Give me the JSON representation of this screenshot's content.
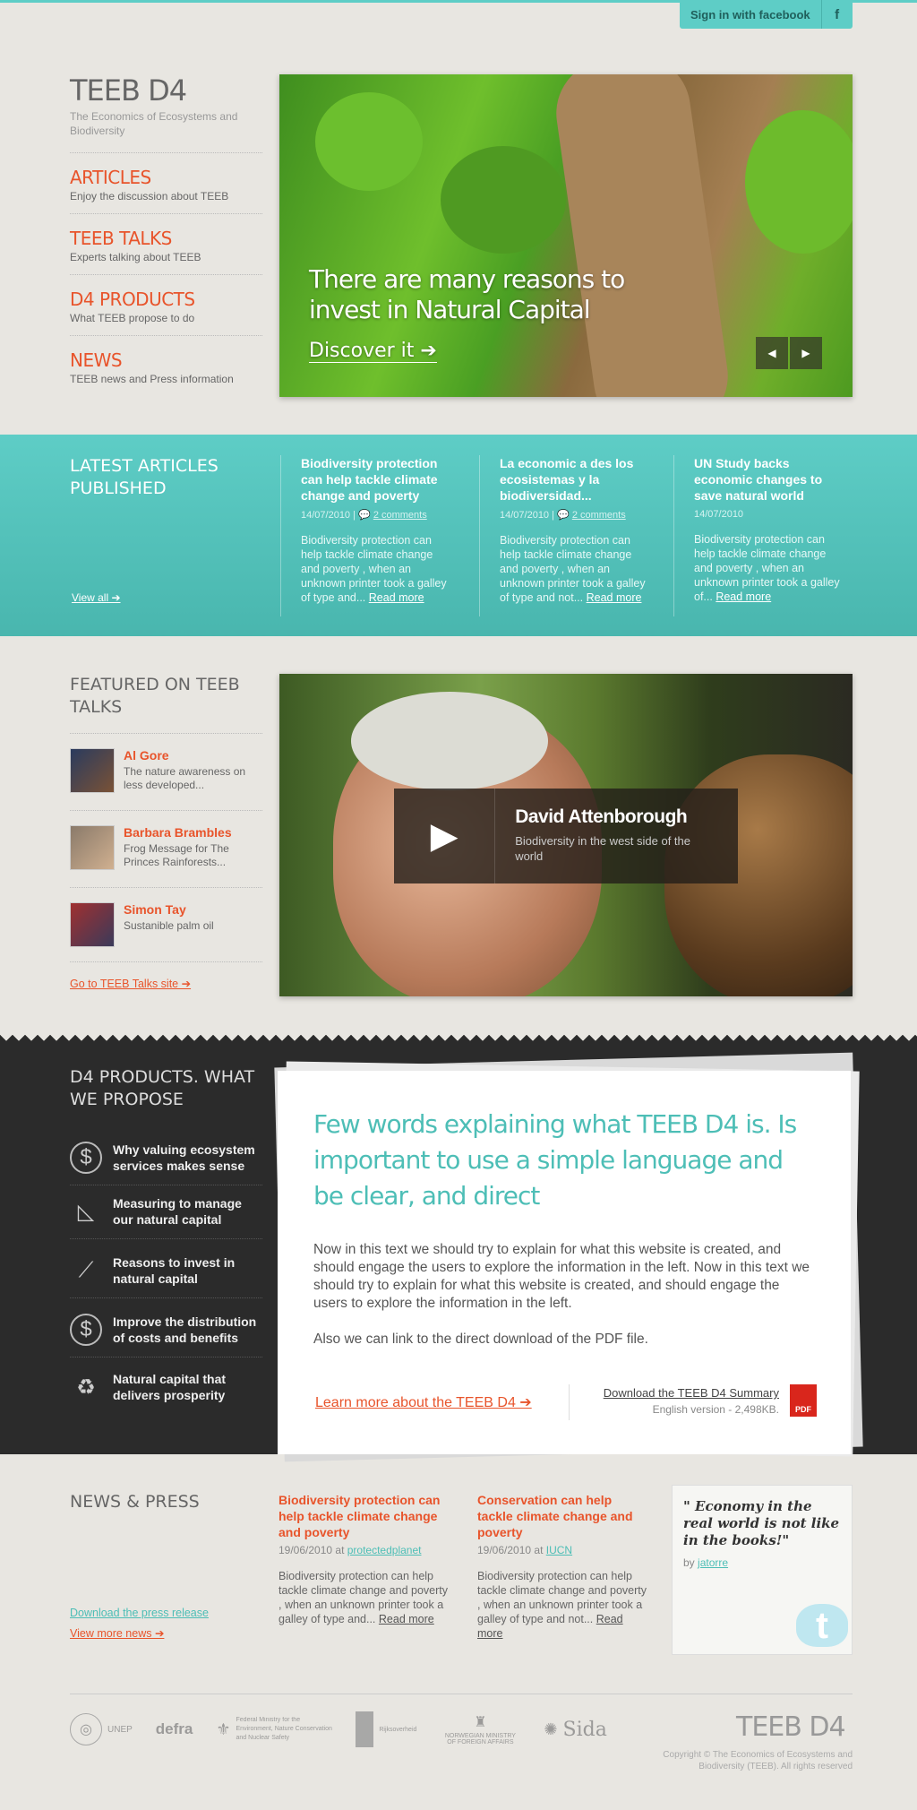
{
  "topbar": {
    "fb_signin": "Sign in with facebook",
    "fb_icon": "f"
  },
  "brand": {
    "title": "TEEB D4",
    "subtitle": "The Economics of Ecosystems and Biodiversity"
  },
  "nav": [
    {
      "title": "ARTICLES",
      "sub": "Enjoy the discussion about TEEB"
    },
    {
      "title": "TEEB TALKS",
      "sub": "Experts talking about TEEB"
    },
    {
      "title": "D4 PRODUCTS",
      "sub": "What TEEB propose to do"
    },
    {
      "title": "NEWS",
      "sub": "TEEB news and Press information"
    }
  ],
  "hero": {
    "headline": "There are many reasons to invest in Natural Capital",
    "cta": "Discover it ➔",
    "prev": "◀",
    "next": "▶"
  },
  "latest": {
    "title": "LATEST ARTICLES PUBLISHED",
    "view_all": "View all ➔",
    "articles": [
      {
        "title": "Biodiversity protection can help tackle climate change and poverty",
        "date": "14/07/2010",
        "comments": "2 comments",
        "body": "Biodiversity protection can help tackle climate change and poverty , when an unknown printer took a galley of type and...",
        "read": "Read more"
      },
      {
        "title": "La economic a des los ecosistemas y la biodiversidad...",
        "date": "14/07/2010",
        "comments": "2 comments",
        "body": "Biodiversity protection can help tackle climate change and poverty , when an unknown printer took a galley of type and not...",
        "read": "Read more"
      },
      {
        "title": "UN Study backs economic changes to save natural world",
        "date": "14/07/2010",
        "comments": "",
        "body": "Biodiversity protection can help tackle climate change and poverty , when an unknown printer took a galley of...",
        "read": "Read more"
      }
    ]
  },
  "featured": {
    "title": "FEATURED ON TEEB TALKS",
    "talks": [
      {
        "name": "Al Gore",
        "desc": "The nature awareness on less developed..."
      },
      {
        "name": "Barbara Brambles",
        "desc": "Frog Message for The Princes Rainforests..."
      },
      {
        "name": "Simon Tay",
        "desc": "Sustanible palm oil"
      }
    ],
    "site_link": "Go to TEEB Talks site ➔",
    "video": {
      "name": "David Attenborough",
      "desc": "Biodiversity in the west side of the world",
      "play": "▶"
    }
  },
  "products": {
    "title": "D4 PRODUCTS. WHAT WE PROPOSE",
    "items": [
      {
        "label": "Why valuing ecosystem services makes sense",
        "icon": "$"
      },
      {
        "label": "Measuring to manage our natural capital",
        "icon": "◺"
      },
      {
        "label": "Reasons to invest in natural capital",
        "icon": "⟋"
      },
      {
        "label": "Improve the distribution of costs and benefits",
        "icon": "$"
      },
      {
        "label": "Natural capital that delivers prosperity",
        "icon": "♻"
      }
    ]
  },
  "about": {
    "headline": "Few words explaining what TEEB D4 is. Is important to use a simple language and be clear, and direct",
    "p1": "Now in this text we should try to explain for what this website is created, and should engage the users to explore the information in the left. Now in this text we should try to explain for what this website is created, and should engage the users to explore the information in the left.",
    "p2": "Also we can link to the direct download of the PDF file.",
    "learn": "Learn more about the TEEB D4 ➔",
    "download": "Download the TEEB D4 Summary",
    "download_sub": "English version - 2,498KB.",
    "pdf": "PDF"
  },
  "news": {
    "title": "NEWS & PRESS",
    "press_link": "Download the press release",
    "more_link": "View more news ➔",
    "items": [
      {
        "title": "Biodiversity protection can help tackle climate change and poverty",
        "date": "19/06/2010 at",
        "source": "protectedplanet",
        "body": "Biodiversity protection can help tackle climate change and poverty , when an unknown printer took a galley of type and...",
        "read": "Read more"
      },
      {
        "title": "Conservation can help tackle climate change and poverty",
        "date": "19/06/2010 at",
        "source": "IUCN",
        "body": "Biodiversity protection can help tackle climate change and poverty , when an unknown printer took a galley of type and not...",
        "read": "Read more"
      }
    ],
    "quote": {
      "text": "\" Economy in the real world is not like in the books!\"",
      "by": "by",
      "author": "jatorre",
      "twitter": "t"
    }
  },
  "footer": {
    "logos": [
      "UNEP",
      "defra",
      "Federal Ministry for the Environment, Nature Conservation and Nuclear Safety",
      "Rijksoverheid",
      "NORWEGIAN MINISTRY OF FOREIGN AFFAIRS",
      "Sida"
    ],
    "brand": "TEEB D4",
    "copyright": "Copyright © The Economics of Ecosystems and Biodiversity (TEEB). All rights reserved"
  }
}
